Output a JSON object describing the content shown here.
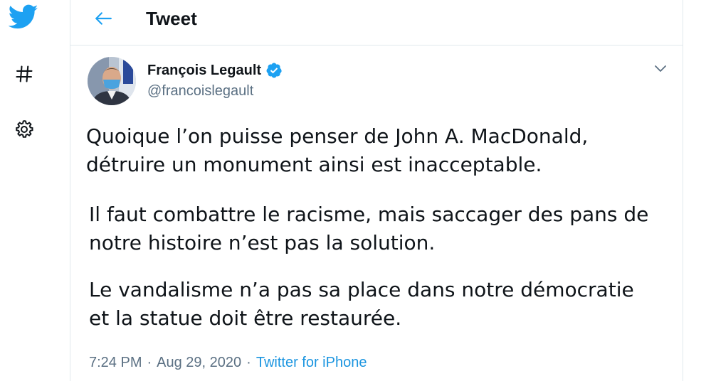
{
  "header": {
    "title": "Tweet"
  },
  "nav": {
    "icons": [
      "twitter-bird-icon",
      "hashtag-icon",
      "gear-icon"
    ]
  },
  "colors": {
    "accent": "#1da1f2",
    "text": "#0f1419",
    "secondary": "#5b7083",
    "link": "#1b95e0"
  },
  "tweet": {
    "author_name": "François Legault",
    "author_handle": "@francoislegault",
    "paragraphs": [
      [
        "Quoique l’on puisse penser de John A. MacDonald,",
        "détruire un monument ainsi est inacceptable."
      ],
      [
        "Il faut combattre le racisme, mais saccager des pans de",
        "notre histoire n’est pas la solution."
      ],
      [
        "Le vandalisme n’a pas sa place dans notre démocratie",
        "et la statue doit être restaurée."
      ]
    ],
    "time": "7:24 PM",
    "date": "Aug 29, 2020",
    "separator": "·",
    "source": "Twitter for iPhone"
  }
}
